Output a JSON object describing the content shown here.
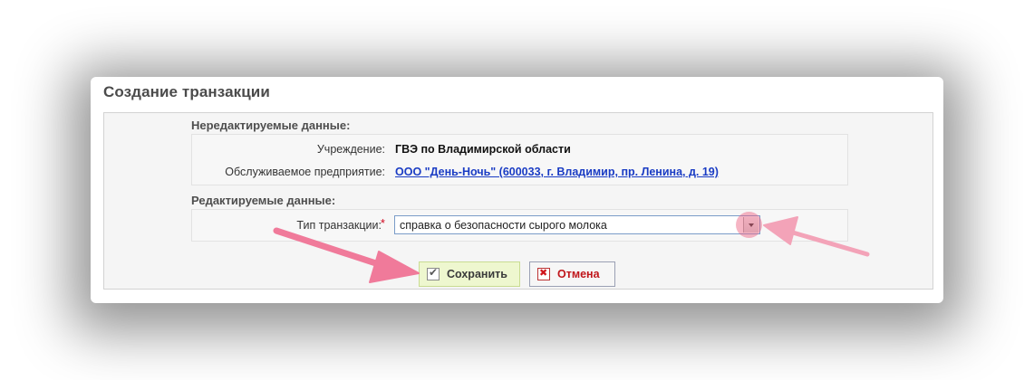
{
  "dialog": {
    "title": "Создание транзакции"
  },
  "readonly_section": {
    "title": "Нередактируемые данные:",
    "fields": [
      {
        "label": "Учреждение:",
        "value": "ГВЭ по Владимирской области"
      },
      {
        "label": "Обслуживаемое предприятие:",
        "value": "ООО \"День-Ночь\" (600033, г. Владимир, пр. Ленина, д. 19)"
      }
    ]
  },
  "editable_section": {
    "title": "Редактируемые данные:",
    "transaction_type": {
      "label": "Тип транзакции:",
      "required_mark": "*",
      "selected": "справка о безопасности сырого молока"
    }
  },
  "buttons": {
    "save_label": "Сохранить",
    "cancel_label": "Отмена"
  },
  "colors": {
    "annotation_arrow": "#f07a9a",
    "highlight_circle": "#ec5a7d",
    "link": "#1a3cc4",
    "cancel_text": "#c0161b",
    "save_background": "#eef7cf"
  },
  "icons": {
    "save": "check-icon",
    "cancel": "x-icon",
    "dropdown": "chevron-down-icon"
  }
}
